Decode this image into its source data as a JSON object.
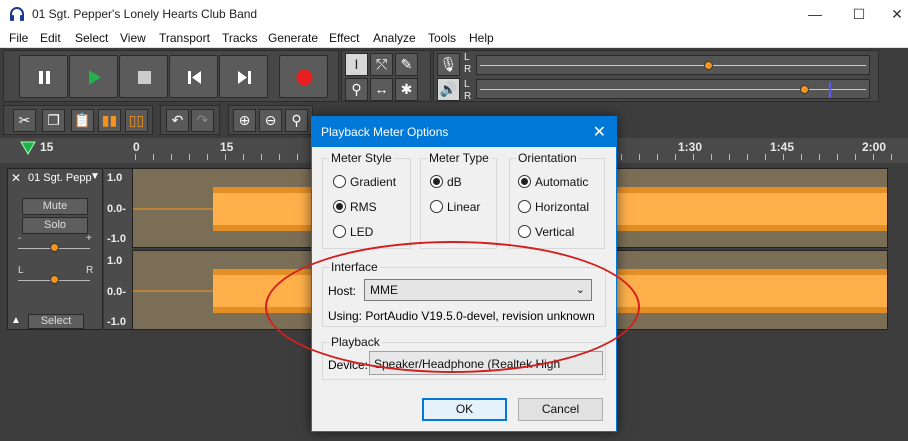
{
  "window": {
    "title": "01 Sgt. Pepper's Lonely Hearts Club Band",
    "minimize": "—",
    "maximize": "☐",
    "close": "✕"
  },
  "menu": [
    "File",
    "Edit",
    "Select",
    "View",
    "Transport",
    "Tracks",
    "Generate",
    "Effect",
    "Analyze",
    "Tools",
    "Help"
  ],
  "meters": {
    "rec_L": "L",
    "rec_R": "R",
    "play_L": "L",
    "play_R": "R"
  },
  "ruler": {
    "ticks": [
      "15",
      "0",
      "15",
      "1:30",
      "1:45",
      "2:00"
    ]
  },
  "track": {
    "name": "01 Sgt. Pepp",
    "mute": "Mute",
    "solo": "Solo",
    "gain_minus": "-",
    "gain_plus": "+",
    "pan_left": "L",
    "pan_right": "R",
    "select": "Select",
    "scale_ch1": [
      "1.0",
      "0.0-",
      "-1.0"
    ],
    "scale_ch2": [
      "1.0",
      "0.0-",
      "-1.0"
    ]
  },
  "dialog": {
    "title": "Playback Meter Options",
    "meter_style": {
      "legend": "Meter Style",
      "options": [
        "Gradient",
        "RMS",
        "LED"
      ],
      "selected": "RMS"
    },
    "meter_type": {
      "legend": "Meter Type",
      "options": [
        "dB",
        "Linear"
      ],
      "selected": "dB"
    },
    "orientation": {
      "legend": "Orientation",
      "options": [
        "Automatic",
        "Horizontal",
        "Vertical"
      ],
      "selected": "Automatic"
    },
    "interface": {
      "legend": "Interface",
      "host_label": "Host:",
      "host_value": "MME",
      "using_text": "Using: PortAudio V19.5.0-devel, revision unknown"
    },
    "playback": {
      "legend": "Playback",
      "device_label": "Device:",
      "device_value": "Speaker/Headphone (Realtek High"
    },
    "ok": "OK",
    "cancel": "Cancel"
  },
  "colors": {
    "waveform": "#f7941d",
    "wave_bg": "#7a6e57",
    "dialog_title": "#0078d7",
    "annotation": "#d21f1f"
  }
}
